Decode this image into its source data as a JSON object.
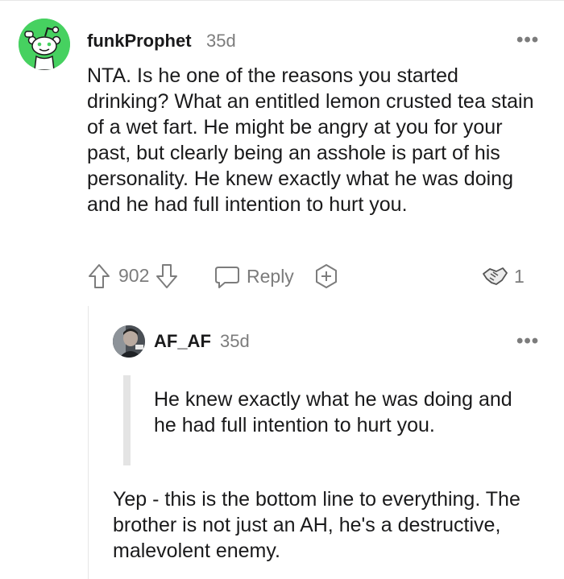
{
  "comment": {
    "username": "funkProphet",
    "age": "35d",
    "more_label": "•••",
    "avatar_icon": "reddit-snoo-avatar",
    "body": "NTA. Is he one of the reasons you started drinking? What an entitled lemon crusted tea stain of a wet fart. He might be angry at you for your past, but clearly being an asshole is part of his personality. He knew exactly what he was doing and he had full intention to hurt you.",
    "votes": "902",
    "reply_label": "Reply",
    "award_count": "1",
    "accent_color": "#46d160"
  },
  "reply": {
    "username": "AF_AF",
    "age": "35d",
    "more_label": "•••",
    "quote": "He knew exactly what he was doing and he had full intention to hurt you.",
    "body": "Yep - this is the bottom line to everything. The brother is not just an AH, he's a destructive, malevolent enemy."
  }
}
